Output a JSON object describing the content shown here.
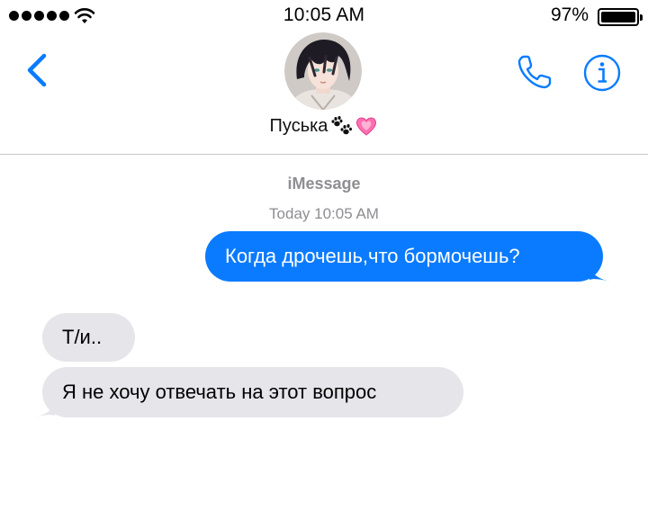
{
  "status_bar": {
    "time": "10:05 AM",
    "battery_percent": "97%",
    "battery_level": 0.97,
    "signal_dots": 5
  },
  "header": {
    "contact_name": "Пуська",
    "contact_emojis": [
      "paw-prints-emoji",
      "growing-heart-emoji"
    ]
  },
  "conversation": {
    "service": "iMessage",
    "timestamp": "Today 10:05 AM",
    "messages": [
      {
        "direction": "sent",
        "text": "Когда дрочешь,что бормочешь?"
      },
      {
        "direction": "received",
        "text": "Т/и.."
      },
      {
        "direction": "received",
        "text": "Я не хочу отвечать на этот вопрос"
      }
    ]
  },
  "colors": {
    "accent": "#0a7bff",
    "sent_bubble": "#0a7bff",
    "received_bubble": "#e5e5ea",
    "meta_text": "#8e8e93"
  }
}
